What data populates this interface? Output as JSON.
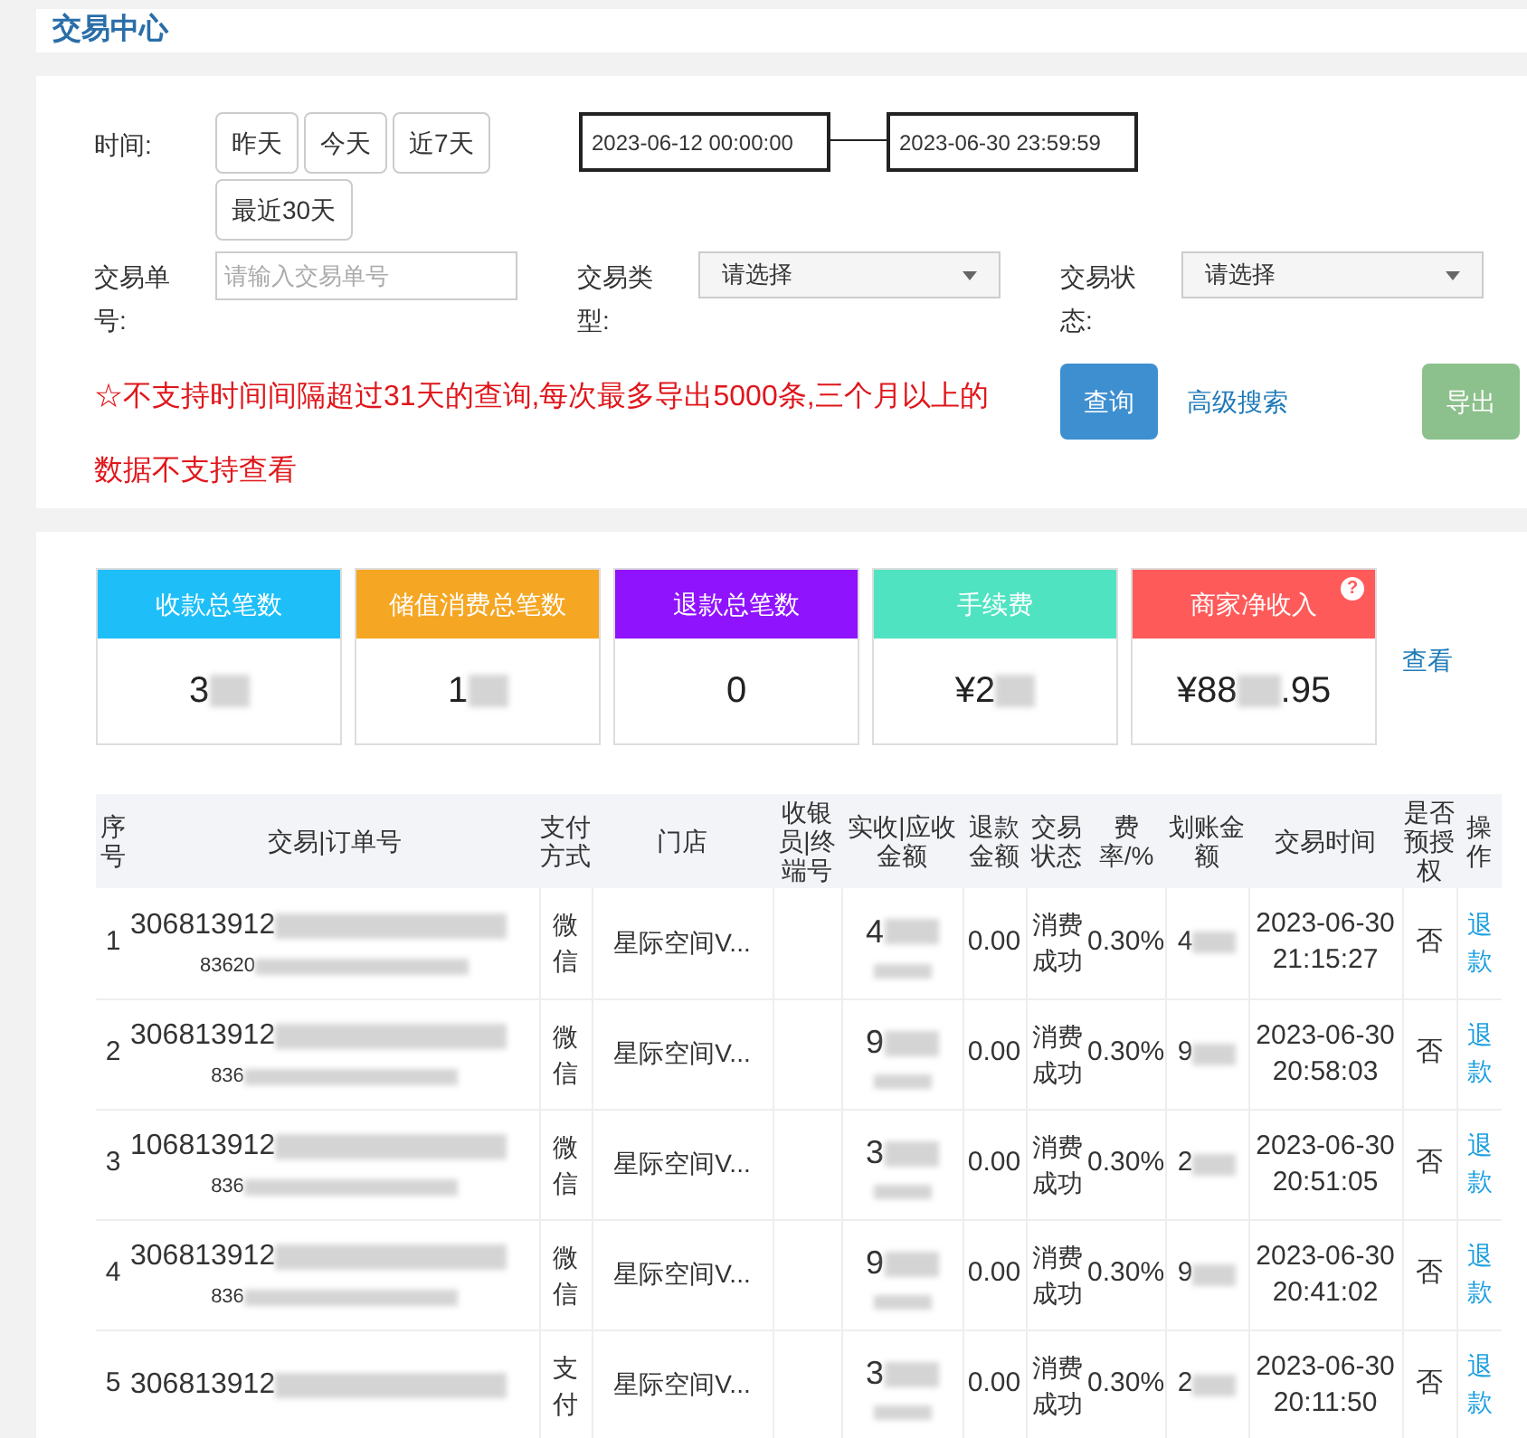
{
  "header": {
    "title": "交易中心"
  },
  "filters": {
    "time_label": "时间:",
    "quick_ranges": [
      {
        "label": "昨天"
      },
      {
        "label": "今天"
      },
      {
        "label": "近7天"
      },
      {
        "label": "最近30天"
      }
    ],
    "start": "2023-06-12 00:00:00",
    "end": "2023-06-30 23:59:59",
    "order_label": "交易单号:",
    "order_placeholder": "请输入交易单号",
    "type_label": "交易类型:",
    "type_value": "请选择",
    "status_label": "交易状态:",
    "status_value": "请选择",
    "notice_mark": "☆",
    "notice": "不支持时间间隔超过31天的查询,每次最多导出5000条,三个月以上的数据不支持查看",
    "query_button": "查询",
    "advanced_link": "高级搜索",
    "export_button": "导出"
  },
  "stats": {
    "cards": [
      {
        "title": "收款总笔数",
        "color": "#1ebff8",
        "prefix": "3",
        "redacted": true
      },
      {
        "title": "储值消费总笔数",
        "color": "#f5a623",
        "prefix": "1",
        "redacted": true
      },
      {
        "title": "退款总笔数",
        "color": "#9013fe",
        "prefix": "0",
        "redacted": false
      },
      {
        "title": "手续费",
        "color": "#50e3c2",
        "prefix": "¥2",
        "redacted": true
      },
      {
        "title": "商家净收入",
        "color": "#ff5a5a",
        "prefix": "¥88",
        "redacted": true,
        "suffix": ".95",
        "help_mark": "?"
      }
    ],
    "view_link": "查看"
  },
  "table": {
    "columns": [
      "序号",
      "交易|订单号",
      "支付方式",
      "门店",
      "收银员|终端号",
      "实收|应收金额",
      "退款金额",
      "交易状态",
      "费率/%",
      "划账金额",
      "交易时间",
      "是否预授权",
      "操作"
    ],
    "rows": [
      {
        "no": "1",
        "order": "306813912",
        "sub_order": "83620",
        "pay": "微信",
        "store": "星际空间V...",
        "amount": "4",
        "refund": "0.00",
        "status": "消费成功",
        "rate": "0.30%",
        "transfer": "4",
        "date": "2023-06-30",
        "time": "21:15:27",
        "preauth": "否",
        "action": "退款"
      },
      {
        "no": "2",
        "order": "306813912",
        "sub_order": "836",
        "pay": "微信",
        "store": "星际空间V...",
        "amount": "9",
        "refund": "0.00",
        "status": "消费成功",
        "rate": "0.30%",
        "transfer": "9",
        "date": "2023-06-30",
        "time": "20:58:03",
        "preauth": "否",
        "action": "退款"
      },
      {
        "no": "3",
        "order": "106813912",
        "sub_order": "836",
        "pay": "微信",
        "store": "星际空间V...",
        "amount": "3",
        "refund": "0.00",
        "status": "消费成功",
        "rate": "0.30%",
        "transfer": "2",
        "date": "2023-06-30",
        "time": "20:51:05",
        "preauth": "否",
        "action": "退款"
      },
      {
        "no": "4",
        "order": "306813912",
        "sub_order": "836",
        "pay": "微信",
        "store": "星际空间V...",
        "amount": "9",
        "refund": "0.00",
        "status": "消费成功",
        "rate": "0.30%",
        "transfer": "9",
        "date": "2023-06-30",
        "time": "20:41:02",
        "preauth": "否",
        "action": "退款"
      },
      {
        "no": "5",
        "order": "306813912",
        "sub_order": "",
        "pay": "支付",
        "store": "星际空间V...",
        "amount": "3",
        "refund": "0.00",
        "status": "消费成功",
        "rate": "0.30%",
        "transfer": "2",
        "date": "2023-06-30",
        "time": "20:11:50",
        "preauth": "否",
        "action": "退款"
      }
    ]
  }
}
